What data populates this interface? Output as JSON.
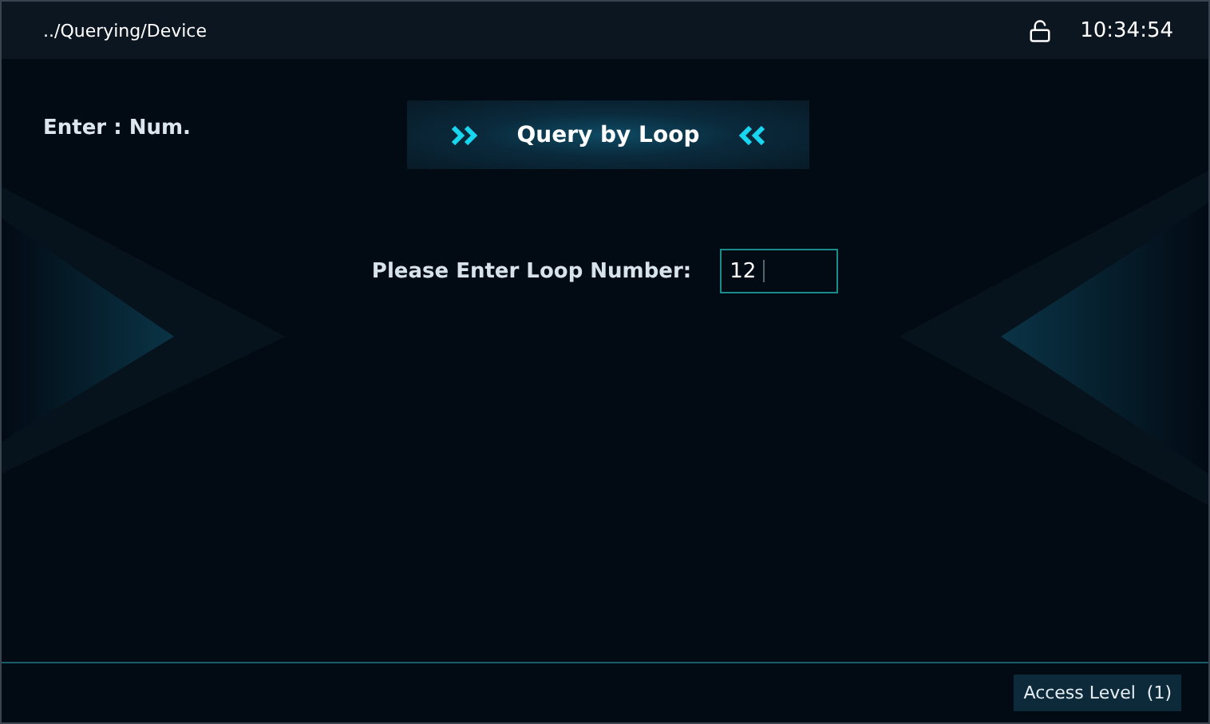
{
  "top_bar": {
    "path": "../Querying/Device",
    "locked": false,
    "time": "10:34:54"
  },
  "side_label": "Enter : Num.",
  "title": "Query by Loop",
  "form": {
    "label": "Please Enter Loop Number:",
    "value": "12"
  },
  "status_bar": {
    "access": "Access Level  (1)"
  }
}
